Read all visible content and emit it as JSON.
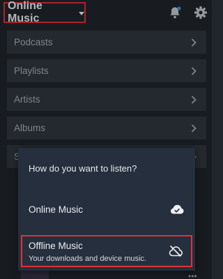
{
  "header": {
    "title": "Online Music",
    "icons": {
      "notifications": "bell-icon",
      "settings": "gear-icon"
    },
    "notification_dot_color": "#2f9bd8"
  },
  "menu": {
    "items": [
      {
        "label": "Podcasts"
      },
      {
        "label": "Playlists"
      },
      {
        "label": "Artists"
      },
      {
        "label": "Albums"
      },
      {
        "label": "S"
      }
    ]
  },
  "dialog": {
    "title": "How do you want to listen?",
    "options": [
      {
        "title": "Online Music",
        "icon": "cloud-check-icon"
      },
      {
        "title": "Offline Music",
        "subtitle": "Your downloads and device music.",
        "icon": "cloud-off-icon"
      }
    ]
  },
  "colors": {
    "background": "#20262c",
    "list_item": "#2f373e",
    "dialog": "#252f3d",
    "highlight": "#e0323a"
  }
}
